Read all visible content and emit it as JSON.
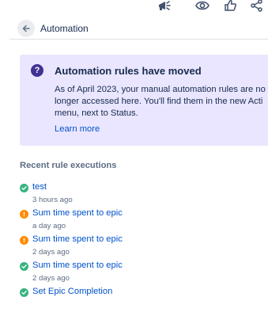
{
  "top_actions": [
    {
      "name": "announcement-icon"
    },
    {
      "name": "eye-icon"
    },
    {
      "name": "thumbs-up-icon"
    },
    {
      "name": "share-icon"
    }
  ],
  "header": {
    "title": "Automation",
    "back_icon": "arrow-left-icon"
  },
  "info_panel": {
    "icon": "question-circle-icon",
    "title": "Automation rules have moved",
    "body_lines": [
      "As of April 2023, your manual automation rules are no",
      "longer accessed here. You'll find them in the new Acti",
      "menu, next to Status."
    ],
    "link": "Learn more"
  },
  "recent": {
    "title": "Recent rule executions",
    "items": [
      {
        "rule": "test",
        "when": "3 hours ago",
        "status": "success"
      },
      {
        "rule": "Sum time spent to epic",
        "when": "a day ago",
        "status": "warning"
      },
      {
        "rule": "Sum time spent to epic",
        "when": "2 days ago",
        "status": "warning"
      },
      {
        "rule": "Sum time spent to epic",
        "when": "2 days ago",
        "status": "success"
      },
      {
        "rule": "Set Epic Completion",
        "when": "",
        "status": "success"
      }
    ]
  },
  "colors": {
    "link": "#0052cc",
    "success": "#36b37e",
    "warning": "#ff8b00",
    "info_bg": "#eae6ff",
    "info_icon": "#403294"
  }
}
